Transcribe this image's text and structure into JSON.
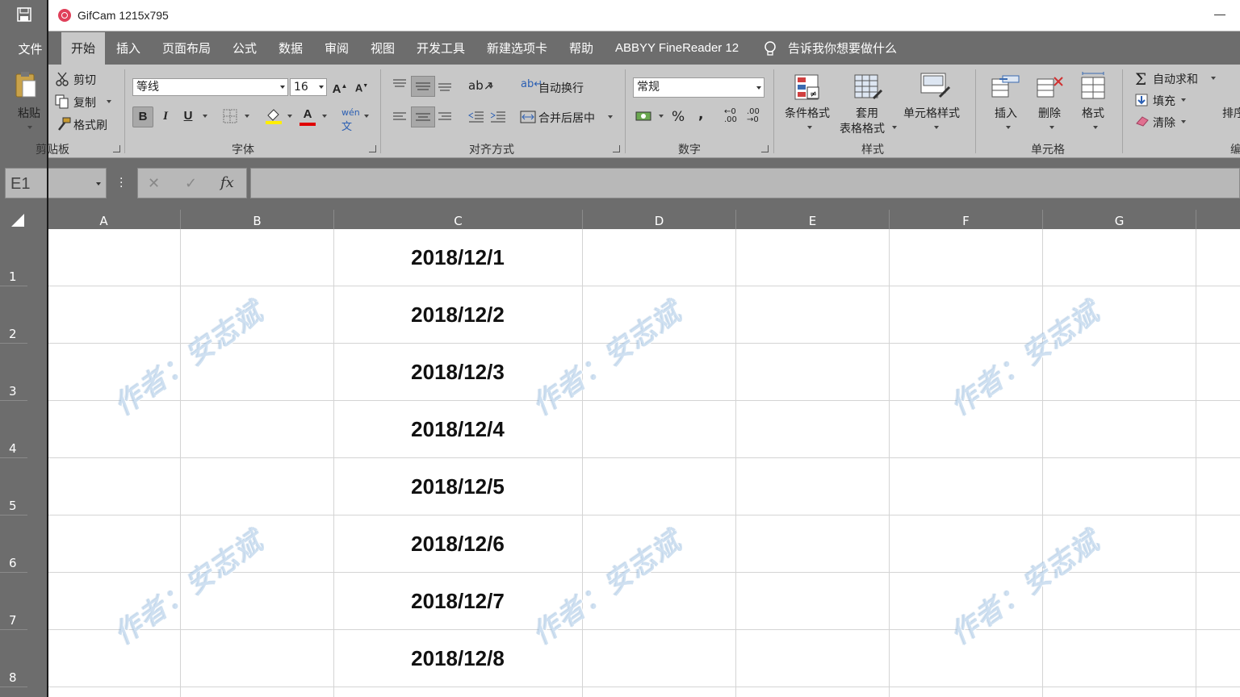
{
  "window": {
    "title": "GifCam 1215x795"
  },
  "ribbon": {
    "file_tab": "文件",
    "tabs": [
      "开始",
      "插入",
      "页面布局",
      "公式",
      "数据",
      "审阅",
      "视图",
      "开发工具",
      "新建选项卡",
      "帮助",
      "ABBYY FineReader 12"
    ],
    "active_tab": "开始",
    "tell_me": "告诉我你想要做什么",
    "clipboard": {
      "paste": "粘贴",
      "cut": "剪切",
      "copy": "复制",
      "format_painter": "格式刷",
      "label": "剪贴板"
    },
    "font": {
      "name": "等线",
      "size": "16",
      "bold": "B",
      "italic": "I",
      "underline": "U",
      "font_color": "A",
      "label": "字体"
    },
    "alignment": {
      "wrap_text": "自动换行",
      "merge_center": "合并后居中",
      "label": "对齐方式"
    },
    "number": {
      "format": "常规",
      "percent": "%",
      "comma": ",",
      "label": "数字"
    },
    "styles": {
      "conditional": "条件格式",
      "table_line1": "套用",
      "table_line2": "表格格式",
      "cell_styles": "单元格样式",
      "label": "样式"
    },
    "cells": {
      "insert": "插入",
      "delete": "删除",
      "format": "格式",
      "label": "单元格"
    },
    "editing": {
      "autosum": "自动求和",
      "fill": "填充",
      "clear": "清除",
      "sort_partial": "排序",
      "label_partial": "编"
    }
  },
  "formula_bar": {
    "name_box": "E1",
    "fx": "fx",
    "cancel": "✕",
    "enter": "✓",
    "value": ""
  },
  "sheet": {
    "columns": [
      "A",
      "B",
      "C",
      "D",
      "E",
      "F",
      "G"
    ],
    "rows": [
      "1",
      "2",
      "3",
      "4",
      "5",
      "6",
      "7",
      "8"
    ],
    "column_c_values": [
      "2018/12/1",
      "2018/12/2",
      "2018/12/3",
      "2018/12/4",
      "2018/12/5",
      "2018/12/6",
      "2018/12/7",
      "2018/12/8"
    ]
  },
  "watermark": "作者：安志斌"
}
